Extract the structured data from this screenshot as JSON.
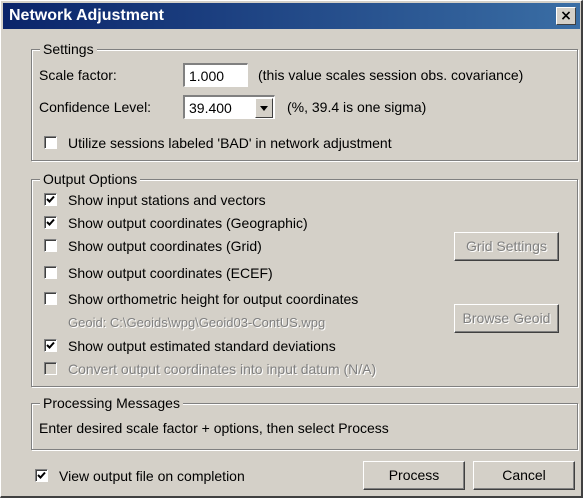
{
  "window": {
    "title": "Network Adjustment",
    "close_glyph": "×"
  },
  "settings": {
    "title": "Settings",
    "scale_factor_label": "Scale factor:",
    "scale_factor_value": "1.000",
    "scale_factor_note": "(this value scales session obs. covariance)",
    "confidence_label": "Confidence Level:",
    "confidence_value": "39.400",
    "confidence_note": "(%, 39.4 is one sigma)",
    "utilize_bad_label": "Utilize sessions labeled 'BAD' in network adjustment",
    "utilize_bad_checked": false
  },
  "output": {
    "title": "Output Options",
    "options": [
      {
        "label": "Show input stations and vectors",
        "checked": true,
        "enabled": true
      },
      {
        "label": "Show output coordinates (Geographic)",
        "checked": true,
        "enabled": true
      },
      {
        "label": "Show output coordinates (Grid)",
        "checked": false,
        "enabled": true
      },
      {
        "label": "Show output coordinates (ECEF)",
        "checked": false,
        "enabled": true
      },
      {
        "label": "Show orthometric height for output coordinates",
        "checked": false,
        "enabled": true
      },
      {
        "label": "Show output estimated standard deviations",
        "checked": true,
        "enabled": true
      },
      {
        "label": "Convert output coordinates into input datum (N/A)",
        "checked": false,
        "enabled": false
      }
    ],
    "geoid_path": "Geoid: C:\\Geoids\\wpg\\Geoid03-ContUS.wpg",
    "grid_settings_label": "Grid Settings",
    "browse_geoid_label": "Browse Geoid"
  },
  "processing": {
    "title": "Processing Messages",
    "message": "Enter desired scale factor + options, then select Process"
  },
  "footer": {
    "view_output_label": "View output file on completion",
    "view_output_checked": true,
    "process_label": "Process",
    "cancel_label": "Cancel"
  },
  "colors": {
    "title_start": "#0a246a",
    "title_end": "#3a6ea5",
    "face": "#d4d0c8",
    "disabled": "#808080"
  }
}
